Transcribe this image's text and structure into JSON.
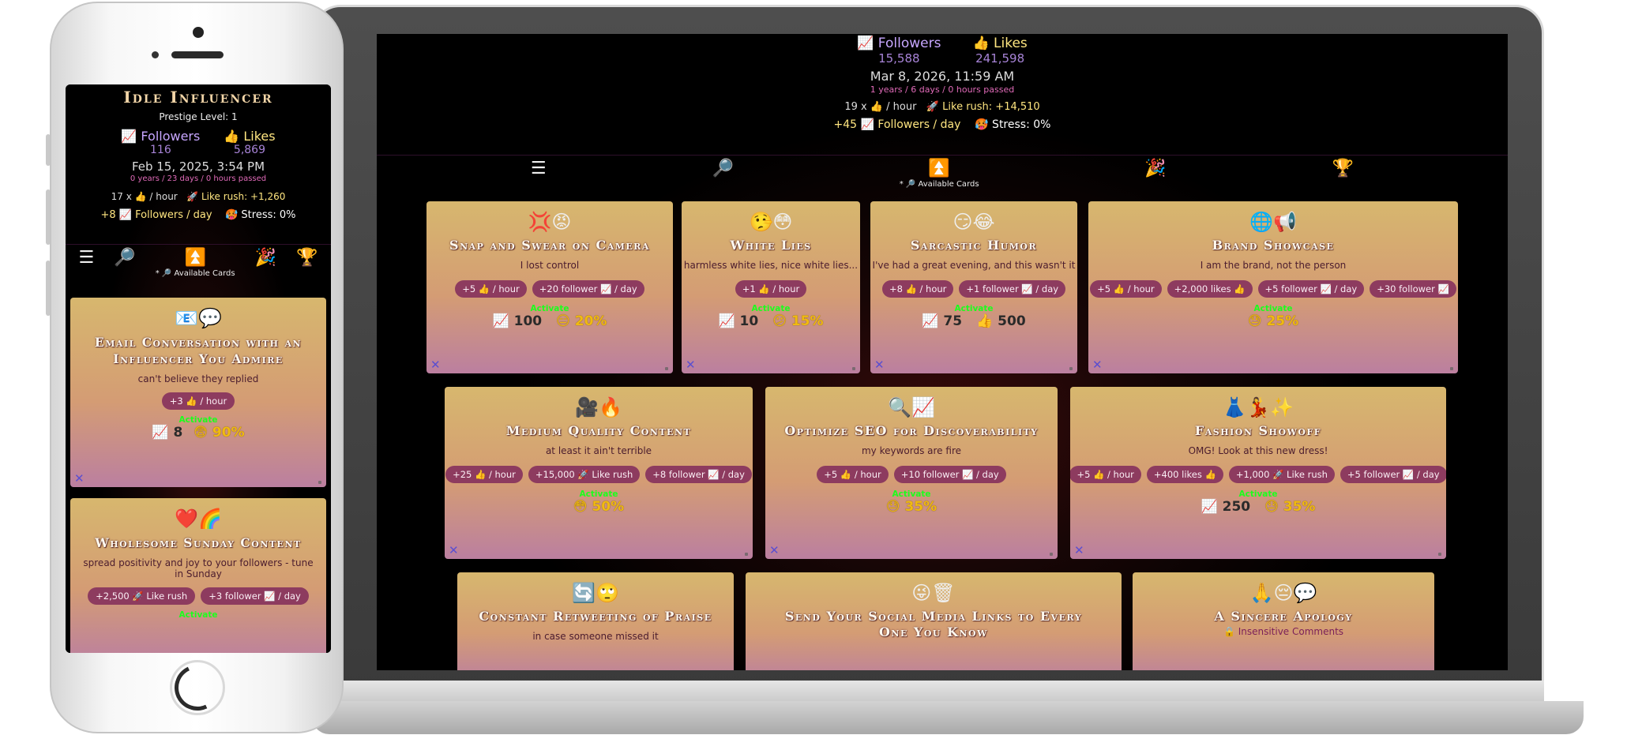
{
  "laptop": {
    "header": {
      "followers_label": "📈 Followers",
      "followers_value": "15,588",
      "likes_label": "👍 Likes",
      "likes_value": "241,598",
      "date": "Mar 8, 2026, 11:59 AM",
      "elapsed": "1 years / 6 days / 0 hours passed",
      "likes_rate": "19 x 👍 / hour",
      "like_rush": "🚀 Like rush: +14,510",
      "followers_rate": "+45 📈 Followers / day",
      "stress": "🥵 Stress: 0%"
    },
    "nav": {
      "menu_icon": "☰",
      "search_icon": "🔎",
      "cards_icon": "⏫",
      "cards_caption": "* 🔎 Available Cards",
      "party_icon": "🎉",
      "trophy_icon": "🏆"
    },
    "cards": [
      {
        "icons": "💢😡",
        "title": "Snap and Swear on Camera",
        "desc": "I lost control",
        "chips": [
          "+5 👍 / hour",
          "+20 follower 📈 / day"
        ],
        "activate": "Activate",
        "stats": [
          "📈 100",
          "😑 20%"
        ],
        "discard": "✕"
      },
      {
        "icons": "🤥😳",
        "title": "White Lies",
        "desc": "harmless white lies, nice white lies...",
        "chips": [
          "+1 👍 / hour"
        ],
        "activate": "Activate",
        "stats": [
          "📈 10",
          "😕 15%"
        ],
        "discard": "✕"
      },
      {
        "icons": "😏😂",
        "title": "Sarcastic Humor",
        "desc": "I've had a great evening, and this wasn't it",
        "chips": [
          "+8 👍 / hour",
          "+1 follower 📈 / day"
        ],
        "activate": "Activate",
        "stats": [
          "📈 75",
          "👍 500"
        ],
        "discard": "✕"
      },
      {
        "icons": "🌐📢",
        "title": "Brand Showcase",
        "desc": "I am the brand, not the person",
        "chips": [
          "+5 👍 / hour",
          "+2,000 likes 👍",
          "+5 follower 📈 / day",
          "+30 follower 📈"
        ],
        "activate": "Activate",
        "stats": [
          "😓 25%"
        ],
        "discard": "✕"
      },
      {
        "icons": "🎥🔥",
        "title": "Medium Quality Content",
        "desc": "at least it ain't terrible",
        "chips": [
          "+25 👍 / hour",
          "+15,000 🚀 Like rush",
          "+8 follower 📈 / day"
        ],
        "activate": "Activate",
        "stats": [
          "😳 50%"
        ],
        "discard": "✕"
      },
      {
        "icons": "🔍📈",
        "title": "Optimize SEO for Discoverability",
        "desc": "my keywords are fire",
        "chips": [
          "+5 👍 / hour",
          "+10 follower 📈 / day"
        ],
        "activate": "Activate",
        "stats": [
          "😓 35%"
        ],
        "discard": "✕"
      },
      {
        "icons": "👗💃✨",
        "title": "Fashion Showoff",
        "desc": "OMG! Look at this new dress!",
        "chips": [
          "+5 👍 / hour",
          "+400 likes 👍",
          "+1,000 🚀 Like rush",
          "+5 follower 📈 / day"
        ],
        "activate": "Activate",
        "stats": [
          "📈 250",
          "😓 35%"
        ],
        "discard": "✕"
      },
      {
        "icons": "🔄🙄",
        "title": "Constant Retweeting of Praise",
        "desc": "in case someone missed it",
        "chips": [],
        "activate": "",
        "stats": [],
        "discard": ""
      },
      {
        "icons": "😜🗑",
        "title": "Send Your Social Media Links to Every One You Know",
        "desc": "",
        "chips": [],
        "activate": "",
        "stats": [],
        "discard": ""
      },
      {
        "icons": "🙏😔💬",
        "title": "A Sincere Apology",
        "desc": "🔒 Insensitive Comments",
        "chips": [],
        "activate": "",
        "stats": [],
        "discard": ""
      }
    ]
  },
  "phone": {
    "header": {
      "title": "Idle Influencer",
      "prestige": "Prestige Level: 1",
      "followers_label": "📈 Followers",
      "followers_value": "116",
      "likes_label": "👍 Likes",
      "likes_value": "5,869",
      "date": "Feb 15, 2025, 3:54 PM",
      "elapsed": "0 years / 23 days / 0 hours passed",
      "likes_rate": "17 x 👍 / hour",
      "like_rush": "🚀 Like rush: +1,260",
      "followers_rate": "+8 📈 Followers / day",
      "stress": "🥵 Stress: 0%"
    },
    "nav": {
      "menu_icon": "☰",
      "search_icon": "🔎",
      "cards_icon": "⏫",
      "cards_caption": "* 🔎 Available Cards",
      "party_icon": "🎉",
      "trophy_icon": "🏆"
    },
    "cards": [
      {
        "icons": "📧💬",
        "title": "Email Conversation with an Influencer You Admire",
        "desc": "can't believe they replied",
        "chips": [
          "+3 👍 / hour"
        ],
        "activate": "Activate",
        "stats": [
          "📈 8",
          "😨 90%"
        ],
        "discard": "✕"
      },
      {
        "icons": "❤️🌈",
        "title": "Wholesome Sunday Content",
        "desc": "spread positivity and joy to your followers - tune in Sunday",
        "chips": [
          "+2,500 🚀 Like rush",
          "+3 follower 📈 / day"
        ],
        "activate": "Activate",
        "stats": [],
        "discard": ""
      }
    ]
  }
}
